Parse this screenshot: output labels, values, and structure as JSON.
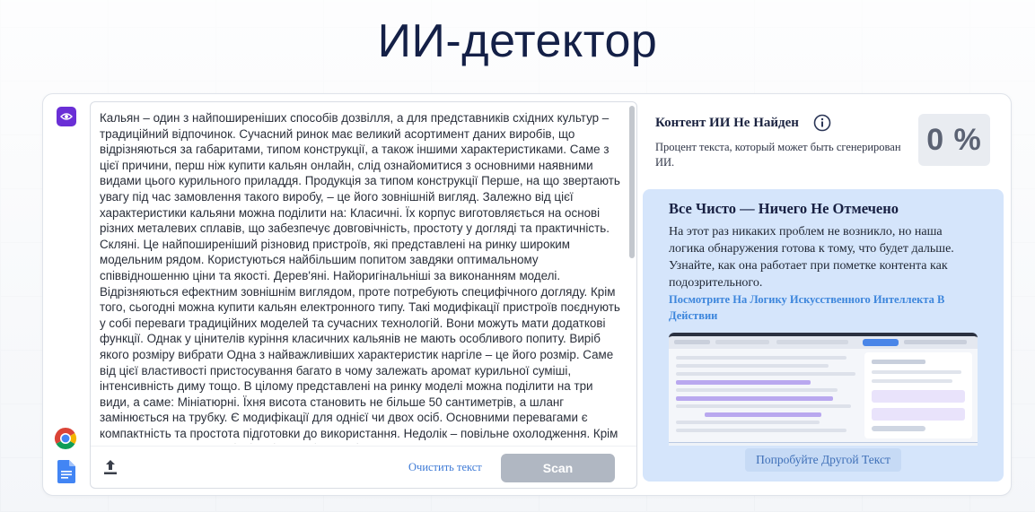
{
  "page": {
    "title": "ИИ-детектор"
  },
  "editor": {
    "text": "Кальян – один з найпоширеніших способів дозвілля, а для представників східних культур – традиційний відпочинок. Сучасний ринок має великий асортимент даних виробів, що відрізняються за габаритами, типом конструкції, а також іншими характеристиками. Саме з цієї причини, перш ніж купити кальян онлайн, слід ознайомитися з основними наявними видами цього курильного приладдя. Продукція за типом конструкції Перше, на що звертають увагу під час замовлення такого виробу, – це його зовнішній вигляд. Залежно від цієї характеристики кальяни можна поділити на: Класичні. Їх корпус виготовляється на основі різних металевих сплавів, що забезпечує довговічність, простоту у догляді та практичність. Скляні. Це найпоширеніший різновид пристроїв, які представлені на ринку широким модельним рядом. Користуються найбільшим попитом завдяки оптимальному співвідношенню ціни та якості. Дерев'яні. Найоригінальніші за виконанням моделі. Відрізняються ефектним зовнішнім виглядом, проте потребують специфічного догляду. Крім того, сьогодні можна купити кальян електронного типу. Такі модифікації пристроїв поєднують у собі переваги традиційних моделей та сучасних технологій. Вони можуть мати додаткові функції. Однак у цінителів куріння класичних кальянів не мають особливого попиту. Виріб якого розміру вибрати Одна з найважливіших характеристик наргіле – це його розмір. Саме від цієї властивості пристосування багато в чому залежать аромат курильної суміші, інтенсивність диму тощо. В цілому представлені на ринку моделі можна поділити на три види, а саме: Мініатюрні. Їхня висота становить не більше 50 сантиметрів, а шланг замінюється на трубку. Є модифікації для однієї чи двох осіб. Основними перевагами є компактність та простота підготовки до використання. Недолік – повільне охолодження. Крім того, при тривалому курінні такі моделі потребують частої",
    "clear_label": "Очистить текст",
    "scan_label": "Scan"
  },
  "result": {
    "title": "Контент ИИ Не Найден",
    "description": "Процент текста, который может быть сгенерирован ИИ.",
    "percent": "0 %"
  },
  "panel": {
    "title": "Все Чисто — Ничего Не Отмечено",
    "body": "На этот раз никаких проблем не возникло, но наша логика обнаружения готова к тому, что будет дальше. Узнайте, как она работает при пометке контента как подозрительного.",
    "link": "Посмотрите На Логику Искусственного Интеллекта В Действии",
    "try_label": "Попробуйте Другой Текст"
  },
  "icons": [
    "eye-icon",
    "chrome-icon",
    "google-docs-icon",
    "upload-icon",
    "info-icon"
  ],
  "colors": {
    "accent": "#6a2fd6",
    "title": "#142047",
    "panel_bg": "#d5e5fb",
    "link": "#3d86dc",
    "scan_disabled": "#b0b7c2"
  }
}
